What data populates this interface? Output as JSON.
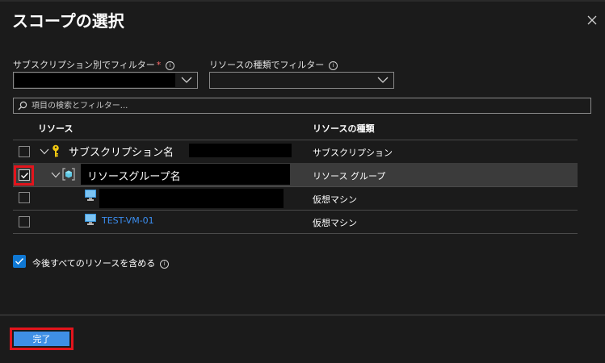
{
  "panel": {
    "title": "スコープの選択"
  },
  "filters": {
    "subscription_label": "サブスクリプション別でフィルター",
    "subscription_required": "*",
    "resource_type_label": "リソースの種類でフィルター"
  },
  "search": {
    "placeholder": "項目の検索とフィルター..."
  },
  "table": {
    "headers": {
      "resource": "リソース",
      "type": "リソースの種類"
    },
    "rows": [
      {
        "name": "サブスクリプション名",
        "type": "サブスクリプション",
        "checked": false,
        "icon": "key-icon"
      },
      {
        "name": "リソースグループ名",
        "type": "リソース グループ",
        "checked": true,
        "icon": "resource-group-icon"
      },
      {
        "name": "",
        "type": "仮想マシン",
        "checked": false,
        "icon": "virtual-machine-icon"
      },
      {
        "name": "TEST-VM-01",
        "type": "仮想マシン",
        "checked": false,
        "icon": "virtual-machine-icon"
      }
    ]
  },
  "include_future": {
    "label": "今後すべてのリソースを含める",
    "checked": true
  },
  "footer": {
    "done_label": "完了"
  },
  "colors": {
    "accent": "#0f78d4",
    "button": "#3f8fe5",
    "highlight": "#e3141c",
    "link": "#3b8ef0"
  }
}
